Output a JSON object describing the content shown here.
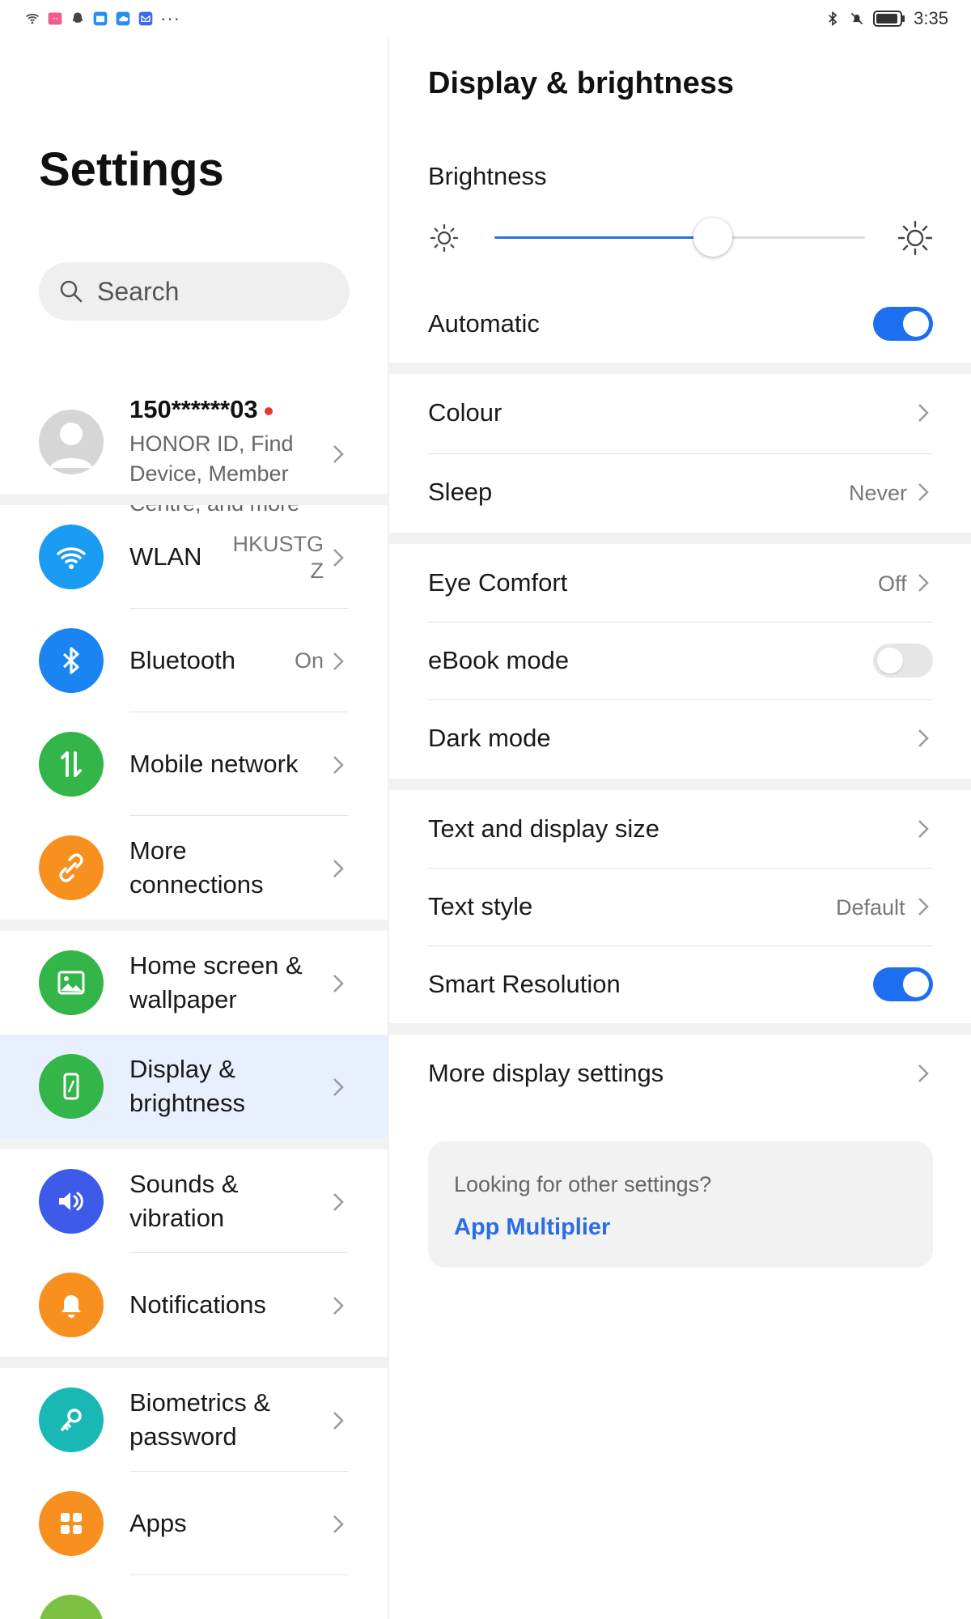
{
  "status_bar": {
    "time": "3:35",
    "left_icons": [
      "wifi-6-icon",
      "app-notification-icon",
      "qq-icon",
      "book-icon",
      "cloud-icon",
      "mail-icon",
      "more-icon"
    ],
    "right_icons": [
      "bluetooth-icon",
      "silent-icon",
      "battery-icon"
    ]
  },
  "left_pane": {
    "title": "Settings",
    "search": {
      "placeholder": "Search"
    },
    "account": {
      "phone": "150******03",
      "description": "HONOR ID, Find Device, Member Centre, and more"
    },
    "items": [
      {
        "label": "WLAN",
        "value": "HKUSTG Z",
        "icon": "wifi-icon",
        "color": "#1a9cf2"
      },
      {
        "label": "Bluetooth",
        "value": "On",
        "icon": "bluetooth-icon",
        "color": "#1a84f2"
      },
      {
        "label": "Mobile network",
        "value": "",
        "icon": "mobile-data-icon",
        "color": "#33b54a"
      },
      {
        "label": "More connections",
        "value": "",
        "icon": "link-icon",
        "color": "#f7901e"
      },
      {
        "label": "Home screen & wallpaper",
        "value": "",
        "icon": "picture-icon",
        "color": "#33b54a"
      },
      {
        "label": "Display & brightness",
        "value": "",
        "icon": "phone-brightness-icon",
        "color": "#33b54a",
        "active": true
      },
      {
        "label": "Sounds & vibration",
        "value": "",
        "icon": "speaker-icon",
        "color": "#3d5be8"
      },
      {
        "label": "Notifications",
        "value": "",
        "icon": "bell-icon",
        "color": "#f7901e"
      },
      {
        "label": "Biometrics & password",
        "value": "",
        "icon": "key-icon",
        "color": "#19b8b5"
      },
      {
        "label": "Apps",
        "value": "",
        "icon": "apps-grid-icon",
        "color": "#f7901e"
      }
    ]
  },
  "right_pane": {
    "title": "Display & brightness",
    "brightness": {
      "label": "Brightness",
      "level_percent": 59
    },
    "automatic": {
      "label": "Automatic",
      "on": true
    },
    "colour": {
      "label": "Colour"
    },
    "sleep": {
      "label": "Sleep",
      "value": "Never"
    },
    "eye_comfort": {
      "label": "Eye Comfort",
      "value": "Off"
    },
    "ebook": {
      "label": "eBook mode",
      "on": false
    },
    "dark_mode": {
      "label": "Dark mode"
    },
    "text_size": {
      "label": "Text and display size"
    },
    "text_style": {
      "label": "Text style",
      "value": "Default"
    },
    "smart_resolution": {
      "label": "Smart Resolution",
      "on": true
    },
    "more_display": {
      "label": "More display settings"
    },
    "card": {
      "question": "Looking for other settings?",
      "link": "App Multiplier"
    }
  },
  "colors": {
    "accent": "#1e6ff0",
    "active_row_bg": "#e8f0fd",
    "link": "#2a6ee3",
    "notification_dot": "#e8362f"
  }
}
